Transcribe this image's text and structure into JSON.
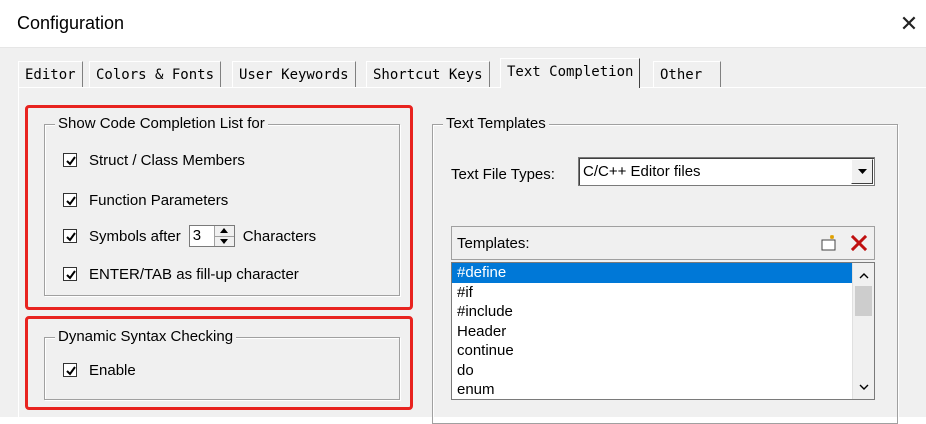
{
  "window": {
    "title": "Configuration",
    "close_glyph": "✕"
  },
  "tabs": [
    {
      "label": "Editor",
      "active": false
    },
    {
      "label": "Colors & Fonts",
      "active": false
    },
    {
      "label": "User Keywords",
      "active": false
    },
    {
      "label": "Shortcut Keys",
      "active": false
    },
    {
      "label": "Text Completion",
      "active": true
    },
    {
      "label": "Other",
      "active": false
    }
  ],
  "code_completion": {
    "legend": "Show Code Completion List for",
    "struct_members": {
      "label": "Struct / Class Members",
      "checked": true
    },
    "function_params": {
      "label": "Function Parameters",
      "checked": true
    },
    "symbols_after": {
      "label": "Symbols after",
      "value": "3",
      "suffix": "Characters",
      "checked": true
    },
    "enter_tab": {
      "label": "ENTER/TAB as fill-up character",
      "checked": true
    }
  },
  "syntax_checking": {
    "legend": "Dynamic Syntax Checking",
    "enable": {
      "label": "Enable",
      "checked": true
    }
  },
  "text_templates": {
    "legend": "Text Templates",
    "file_types_label": "Text File Types:",
    "file_types_value": "C/C++ Editor files",
    "templates_label": "Templates:",
    "items": [
      "#define",
      "#if",
      "#include",
      "Header",
      "continue",
      "do",
      "enum"
    ],
    "selected_index": 0
  },
  "colors": {
    "highlight": "#e8231f",
    "selection": "#0078d7"
  },
  "icons": {
    "new_template": "new-item-icon",
    "delete_template": "delete-x-icon"
  }
}
